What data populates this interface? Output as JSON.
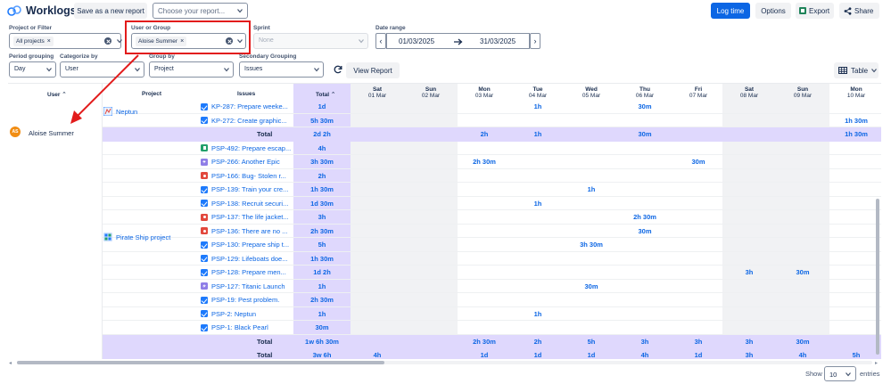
{
  "header": {
    "title": "Worklogs",
    "save_report": "Save as a new report",
    "choose_report_placeholder": "Choose your report...",
    "log_time": "Log time",
    "options": "Options",
    "export": "Export",
    "share": "Share"
  },
  "filters": {
    "project_label": "Project or Filter",
    "project_tag": "All projects",
    "user_label": "User or Group",
    "user_tag": "Aloise Summer",
    "sprint_label": "Sprint",
    "sprint_placeholder": "None",
    "date_label": "Date range",
    "date_from": "01/03/2025",
    "date_to": "31/03/2025",
    "period_label": "Period grouping",
    "period_value": "Day",
    "categorize_label": "Categorize by",
    "categorize_value": "User",
    "group_label": "Group by",
    "group_value": "Project",
    "secondary_label": "Secondary Grouping",
    "secondary_value": "Issues",
    "view_report": "View Report",
    "table_view": "Table"
  },
  "table": {
    "headers": {
      "user": "User",
      "project": "Project",
      "issues": "Issues",
      "total": "Total"
    },
    "days": [
      {
        "d": "Sat",
        "date": "01 Mar"
      },
      {
        "d": "Sun",
        "date": "02 Mar"
      },
      {
        "d": "Mon",
        "date": "03 Mar"
      },
      {
        "d": "Tue",
        "date": "04 Mar"
      },
      {
        "d": "Wed",
        "date": "05 Mar"
      },
      {
        "d": "Thu",
        "date": "06 Mar"
      },
      {
        "d": "Fri",
        "date": "07 Mar"
      },
      {
        "d": "Sat",
        "date": "08 Mar"
      },
      {
        "d": "Sun",
        "date": "09 Mar"
      },
      {
        "d": "Mon",
        "date": "10 Mar"
      }
    ],
    "user_name": "Aloise Summer",
    "user_initials": "AS",
    "projects": {
      "neptun": "Neptun",
      "pirate": "Pirate Ship project"
    },
    "neptun_rows": [
      {
        "key": "KP-287: Prepare weeke...",
        "type": "task",
        "total": "1d",
        "cells": [
          "",
          "",
          "",
          "1h",
          "",
          "30m",
          "",
          "",
          "",
          ""
        ]
      },
      {
        "key": "KP-272: Create graphic...",
        "type": "task",
        "total": "5h 30m",
        "cells": [
          "",
          "",
          "",
          "",
          "",
          "",
          "",
          "",
          "",
          "1h 30m"
        ]
      }
    ],
    "neptun_total": {
      "label": "Total",
      "total": "2d 2h",
      "cells": [
        "",
        "",
        "2h",
        "1h",
        "",
        "30m",
        "",
        "",
        "",
        "1h 30m"
      ]
    },
    "pirate_rows": [
      {
        "key": "PSP-492: Prepare escap...",
        "type": "story",
        "total": "4h",
        "cells": [
          "",
          "",
          "",
          "",
          "",
          "",
          "",
          "",
          "",
          ""
        ]
      },
      {
        "key": "PSP-266: Another Epic",
        "type": "epic",
        "total": "3h 30m",
        "cells": [
          "",
          "",
          "2h 30m",
          "",
          "",
          "",
          "30m",
          "",
          "",
          ""
        ]
      },
      {
        "key": "PSP-166: Bug- Stolen r...",
        "type": "bug",
        "total": "2h",
        "cells": [
          "",
          "",
          "",
          "",
          "",
          "",
          "",
          "",
          "",
          ""
        ]
      },
      {
        "key": "PSP-139: Train your cre...",
        "type": "task",
        "total": "1h 30m",
        "cells": [
          "",
          "",
          "",
          "",
          "1h",
          "",
          "",
          "",
          "",
          ""
        ]
      },
      {
        "key": "PSP-138: Recruit securi...",
        "type": "task",
        "total": "1d 30m",
        "cells": [
          "",
          "",
          "",
          "1h",
          "",
          "",
          "",
          "",
          "",
          ""
        ]
      },
      {
        "key": "PSP-137: The life jacket...",
        "type": "bug",
        "total": "3h",
        "cells": [
          "",
          "",
          "",
          "",
          "",
          "2h 30m",
          "",
          "",
          "",
          ""
        ]
      },
      {
        "key": "PSP-136: There are no ...",
        "type": "bug",
        "total": "2h 30m",
        "cells": [
          "",
          "",
          "",
          "",
          "",
          "30m",
          "",
          "",
          "",
          ""
        ]
      },
      {
        "key": "PSP-130: Prepare ship t...",
        "type": "task",
        "total": "5h",
        "cells": [
          "",
          "",
          "",
          "",
          "3h 30m",
          "",
          "",
          "",
          "",
          ""
        ]
      },
      {
        "key": "PSP-129: Lifeboats doe...",
        "type": "task",
        "total": "1h 30m",
        "cells": [
          "",
          "",
          "",
          "",
          "",
          "",
          "",
          "",
          "",
          ""
        ]
      },
      {
        "key": "PSP-128: Prepare men...",
        "type": "task",
        "total": "1d 2h",
        "cells": [
          "",
          "",
          "",
          "",
          "",
          "",
          "",
          "3h",
          "30m",
          ""
        ]
      },
      {
        "key": "PSP-127: Titanic Launch",
        "type": "epic",
        "total": "1h",
        "cells": [
          "",
          "",
          "",
          "",
          "30m",
          "",
          "",
          "",
          "",
          ""
        ]
      },
      {
        "key": "PSP-19: Pest problem.",
        "type": "task",
        "total": "2h 30m",
        "cells": [
          "",
          "",
          "",
          "",
          "",
          "",
          "",
          "",
          "",
          ""
        ]
      },
      {
        "key": "PSP-2: Neptun",
        "type": "task",
        "total": "1h",
        "cells": [
          "",
          "",
          "",
          "1h",
          "",
          "",
          "",
          "",
          "",
          ""
        ]
      },
      {
        "key": "PSP-1: Black Pearl",
        "type": "task",
        "total": "30m",
        "cells": [
          "",
          "",
          "",
          "",
          "",
          "",
          "",
          "",
          "",
          ""
        ]
      }
    ],
    "pirate_total": {
      "label": "Total",
      "total": "1w 6h 30m",
      "cells": [
        "",
        "",
        "2h 30m",
        "2h",
        "5h",
        "3h",
        "3h",
        "3h",
        "30m",
        ""
      ]
    },
    "grand_total": {
      "label": "Total",
      "total": "3w 6h",
      "cells": [
        "4h",
        "",
        "1d",
        "1d",
        "1d",
        "4h",
        "1d",
        "3h",
        "4h",
        "5h"
      ]
    }
  },
  "footer": {
    "show": "Show",
    "page_size": "10",
    "entries": "entries"
  }
}
